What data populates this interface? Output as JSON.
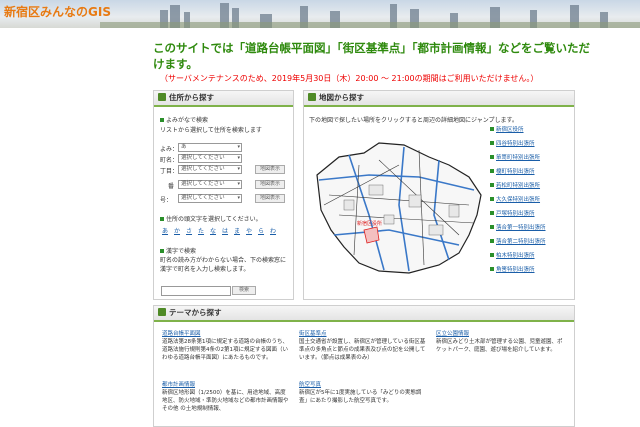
{
  "site_title": "新宿区みんなのGIS",
  "headline": "このサイトでは「道路台帳平面図」「街区基準点」「都市計画情報」などをご覧いただけます。",
  "notice": "（サーバメンテナンスのため、2019年5月30日（木）20:00 ～ 21:00の期間はご利用いただけません。）",
  "address_panel": {
    "title": "住所から探す",
    "section1_title": "よみがなで検索",
    "section1_desc": "リストから選択して住所を検索します",
    "yomi_label": "よみ：",
    "yomi_value": "あ",
    "machi_label": "町名：",
    "chome_label": "丁目：",
    "ban_label": "番",
    "go_label": "号：",
    "select_placeholder": "選択してください",
    "map_button": "地図表示",
    "section2_title": "住所の頭文字を選択してください。",
    "kana": [
      "あ",
      "か",
      "さ",
      "た",
      "な",
      "は",
      "ま",
      "や",
      "ら",
      "わ"
    ],
    "section3_title": "漢字で検索",
    "section3_desc": "町名の読み方がわからない場合、下の検索窓に漢字で町名を入力し検索します。",
    "search_button": "検索"
  },
  "map_panel": {
    "title": "地図から探す",
    "desc": "下の地図で探したい場所をクリックすると周辺の詳細地図にジャンプします。",
    "districts": [
      "新宿区役所",
      "四谷特別出張所",
      "箪笥町特別出張所",
      "榎町特別出張所",
      "若松町特別出張所",
      "大久保特別出張所",
      "戸塚特別出張所",
      "落合第一特別出張所",
      "落合第二特別出張所",
      "柏木特別出張所",
      "角筈特別出張所"
    ],
    "map_label": "新宿区役所"
  },
  "theme_panel": {
    "title": "テーマから探す",
    "items": [
      {
        "title": "道路台帳平面図",
        "desc": "道路法第28条第1項に規定する道路の台帳のうち、道路法施行規則第4条の2第1項に規定する図面（いわゆる道路台帳平面図）にあたるものです。"
      },
      {
        "title": "都市計画情報",
        "desc": "新宿区地形図（1/2500）を基に、用途地域、高度地区、防火地域・準防火地域などの都市計画情報やその他 の土地規制情報、"
      },
      {
        "title": "街区基準点",
        "desc": "国土交通省が設置し、新宿区が管理している街区基準点の多角点と節点の成果表及び点の記を公開しています。（節点は成果表のみ）"
      },
      {
        "title": "航空写真",
        "desc": "新宿区が5年に1度実施している「みどりの実態調査」にあたり撮影した航空写真です。"
      },
      {
        "title": "区立公園情報",
        "desc": "新宿区みどり土木部が管理する公園、児童遊園、ポケットパーク、庭園、遊び場を紹介しています。"
      }
    ]
  },
  "colors": {
    "accent_green": "#2f8a0e",
    "notice_red": "#e00000",
    "link_blue": "#1a5ea8",
    "title_orange": "#e87a12"
  }
}
